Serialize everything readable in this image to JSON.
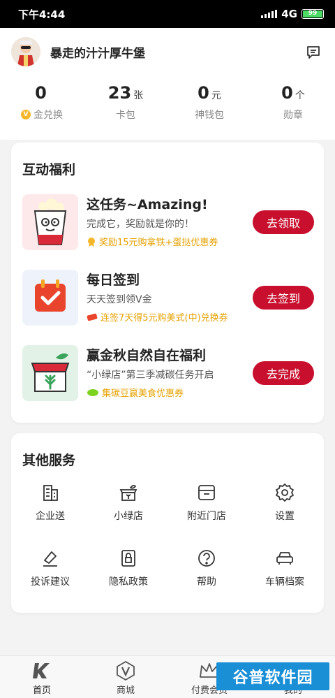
{
  "status_bar": {
    "time": "下午4:44",
    "network": "4G",
    "battery": "99"
  },
  "header": {
    "username": "暴走的汁汁厚牛堡",
    "stats": [
      {
        "value": "0",
        "unit": "",
        "label": "金兑换"
      },
      {
        "value": "23",
        "unit": "张",
        "label": "卡包"
      },
      {
        "value": "0",
        "unit": "元",
        "label": "神钱包"
      },
      {
        "value": "0",
        "unit": "个",
        "label": "勋章"
      }
    ]
  },
  "welfare": {
    "title": "互动福利",
    "tasks": [
      {
        "title": "这任务~Amazing!",
        "desc": "完成它，奖励就是你的！",
        "reward": "奖励15元购拿铁+蛋挞优惠券",
        "button": "去领取"
      },
      {
        "title": "每日签到",
        "desc": "天天签到领V金",
        "reward": "连签7天得5元购美式(中)兑换券",
        "button": "去签到"
      },
      {
        "title": "赢金秋自然自在福利",
        "desc": "“小绿店”第三季减碳任务开启",
        "reward": "集碳豆赢美食优惠券",
        "button": "去完成"
      }
    ]
  },
  "services": {
    "title": "其他服务",
    "items": [
      {
        "label": "企业送",
        "icon": "building-icon"
      },
      {
        "label": "小绿店",
        "icon": "green-store-icon"
      },
      {
        "label": "附近门店",
        "icon": "store-icon"
      },
      {
        "label": "设置",
        "icon": "gear-icon"
      },
      {
        "label": "投诉建议",
        "icon": "feedback-icon"
      },
      {
        "label": "隐私政策",
        "icon": "privacy-icon"
      },
      {
        "label": "帮助",
        "icon": "help-icon"
      },
      {
        "label": "车辆档案",
        "icon": "car-icon"
      }
    ]
  },
  "tabbar": {
    "items": [
      {
        "label": "首页",
        "icon": "home-k-icon"
      },
      {
        "label": "商城",
        "icon": "mall-v-icon"
      },
      {
        "label": "付费会员",
        "icon": "crown-icon"
      },
      {
        "label": "我的",
        "icon": "profile-icon"
      }
    ]
  },
  "watermark": "谷普软件园",
  "colors": {
    "accent": "#c8102e",
    "reward": "#e5a100",
    "battery": "#4cd964"
  }
}
